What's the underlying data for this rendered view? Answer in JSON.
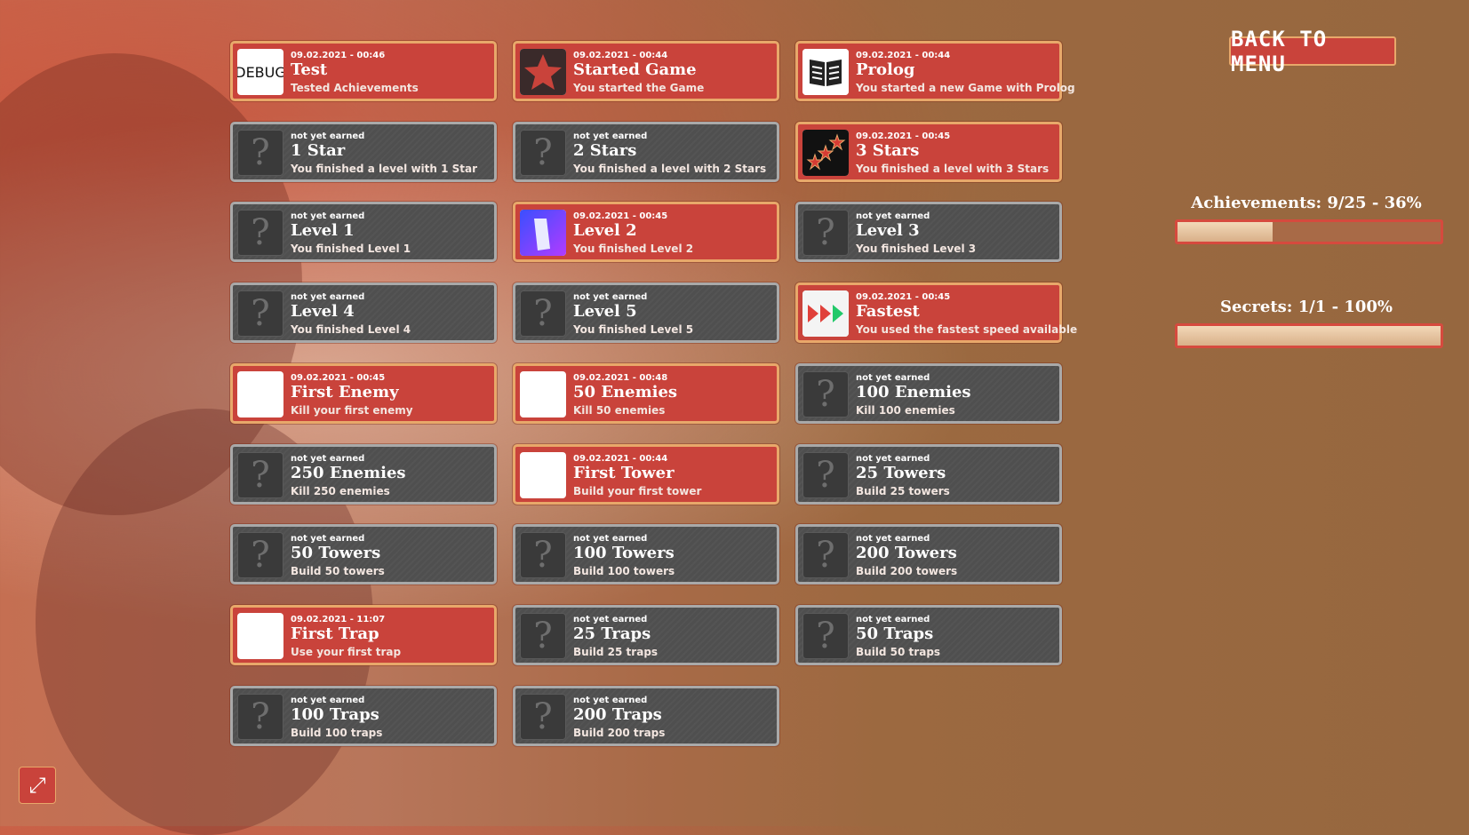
{
  "back_button": "BACK TO MENU",
  "stats": {
    "achievements_label": "Achievements: 9/25 - 36%",
    "achievements_progress": 0.36,
    "secrets_label": "Secrets: 1/1 - 100%",
    "secrets_progress": 1.0
  },
  "colors": {
    "earned_bg": "#c9433b",
    "earned_border": "#e8a86a",
    "locked_bg": "#4f4f4f",
    "locked_border": "#a9a9a9"
  },
  "achievements": [
    {
      "date": "09.02.2021 - 00:46",
      "title": "Test",
      "desc": "Tested Achievements",
      "earned": true,
      "icon": "debug-icon",
      "icon_text": "DEBUG"
    },
    {
      "date": "09.02.2021 - 00:44",
      "title": "Started Game",
      "desc": "You started the Game",
      "earned": true,
      "icon": "star-icon"
    },
    {
      "date": "09.02.2021 - 00:44",
      "title": "Prolog",
      "desc": "You started a new Game with Prolog",
      "earned": true,
      "icon": "book-icon"
    },
    {
      "date": "not yet earned",
      "title": "1 Star",
      "desc": "You finished a level with 1 Star",
      "earned": false,
      "icon": "question-icon"
    },
    {
      "date": "not yet earned",
      "title": "2 Stars",
      "desc": "You finished a level with 2 Stars",
      "earned": false,
      "icon": "question-icon"
    },
    {
      "date": "09.02.2021 - 00:45",
      "title": "3 Stars",
      "desc": "You finished a level with 3 Stars",
      "earned": true,
      "icon": "three-stars-icon"
    },
    {
      "date": "not yet earned",
      "title": "Level 1",
      "desc": "You finished Level 1",
      "earned": false,
      "icon": "question-icon"
    },
    {
      "date": "09.02.2021 - 00:45",
      "title": "Level 2",
      "desc": "You finished Level 2",
      "earned": true,
      "icon": "level2-icon"
    },
    {
      "date": "not yet earned",
      "title": "Level 3",
      "desc": "You finished Level 3",
      "earned": false,
      "icon": "question-icon"
    },
    {
      "date": "not yet earned",
      "title": "Level 4",
      "desc": "You finished Level 4",
      "earned": false,
      "icon": "question-icon"
    },
    {
      "date": "not yet earned",
      "title": "Level 5",
      "desc": "You finished Level 5",
      "earned": false,
      "icon": "question-icon"
    },
    {
      "date": "09.02.2021 - 00:45",
      "title": "Fastest",
      "desc": "You used the fastest speed available",
      "earned": true,
      "icon": "fast-forward-icon"
    },
    {
      "date": "09.02.2021 - 00:45",
      "title": "First Enemy",
      "desc": "Kill your first enemy",
      "earned": true,
      "icon": "blank-icon"
    },
    {
      "date": "09.02.2021 - 00:48",
      "title": "50 Enemies",
      "desc": "Kill 50 enemies",
      "earned": true,
      "icon": "blank-icon"
    },
    {
      "date": "not yet earned",
      "title": "100 Enemies",
      "desc": "Kill 100 enemies",
      "earned": false,
      "icon": "question-icon"
    },
    {
      "date": "not yet earned",
      "title": "250 Enemies",
      "desc": "Kill 250 enemies",
      "earned": false,
      "icon": "question-icon"
    },
    {
      "date": "09.02.2021 - 00:44",
      "title": "First Tower",
      "desc": "Build your first tower",
      "earned": true,
      "icon": "blank-icon"
    },
    {
      "date": "not yet earned",
      "title": "25 Towers",
      "desc": "Build 25 towers",
      "earned": false,
      "icon": "question-icon"
    },
    {
      "date": "not yet earned",
      "title": "50 Towers",
      "desc": "Build 50 towers",
      "earned": false,
      "icon": "question-icon"
    },
    {
      "date": "not yet earned",
      "title": "100 Towers",
      "desc": "Build 100 towers",
      "earned": false,
      "icon": "question-icon"
    },
    {
      "date": "not yet earned",
      "title": "200 Towers",
      "desc": "Build 200 towers",
      "earned": false,
      "icon": "question-icon"
    },
    {
      "date": "09.02.2021 - 11:07",
      "title": "First Trap",
      "desc": "Use your first trap",
      "earned": true,
      "icon": "blank-icon"
    },
    {
      "date": "not yet earned",
      "title": "25 Traps",
      "desc": "Build 25 traps",
      "earned": false,
      "icon": "question-icon"
    },
    {
      "date": "not yet earned",
      "title": "50 Traps",
      "desc": "Build 50 traps",
      "earned": false,
      "icon": "question-icon"
    },
    {
      "date": "not yet earned",
      "title": "100 Traps",
      "desc": "Build 100 traps",
      "earned": false,
      "icon": "question-icon"
    },
    {
      "date": "not yet earned",
      "title": "200 Traps",
      "desc": "Build 200 traps",
      "earned": false,
      "icon": "question-icon"
    }
  ]
}
